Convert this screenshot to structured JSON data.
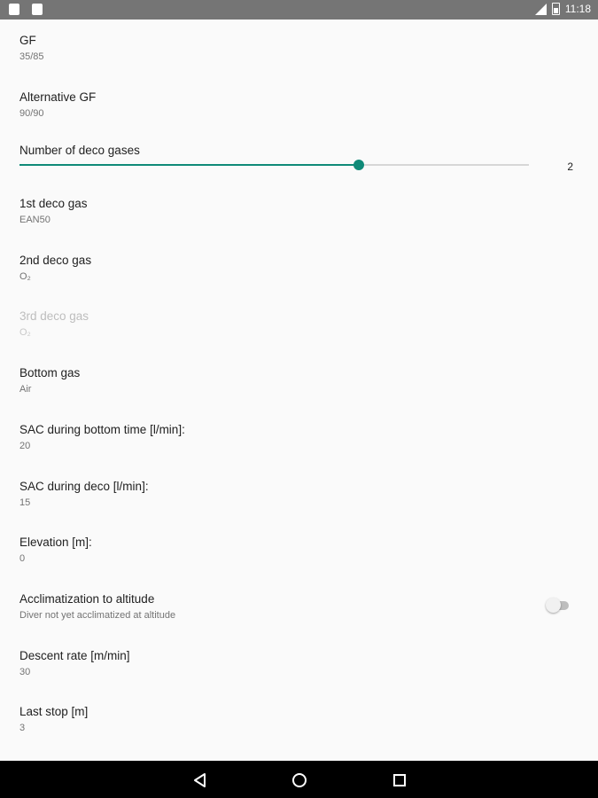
{
  "status_bar": {
    "time": "11:18",
    "left_icons": [
      "notification-icon",
      "notification-icon"
    ],
    "right_icons": [
      "signal-icon",
      "battery-icon"
    ]
  },
  "preferences": [
    {
      "id": "gf",
      "title": "GF",
      "summary": "35/85",
      "enabled": true
    },
    {
      "id": "alt-gf",
      "title": "Alternative GF",
      "summary": "90/90",
      "enabled": true
    },
    {
      "id": "deco-gases",
      "title": "Number of deco gases",
      "slider_value": "2",
      "slider_min": 0,
      "slider_max": 3,
      "enabled": true
    },
    {
      "id": "deco-gas-1",
      "title": "1st deco gas",
      "summary": "EAN50",
      "enabled": true
    },
    {
      "id": "deco-gas-2",
      "title": "2nd deco gas",
      "summary": "O₂",
      "enabled": true
    },
    {
      "id": "deco-gas-3",
      "title": "3rd deco gas",
      "summary": "O₂",
      "enabled": false
    },
    {
      "id": "bottom-gas",
      "title": "Bottom gas",
      "summary": "Air",
      "enabled": true
    },
    {
      "id": "sac-bottom",
      "title": "SAC during bottom time [l/min]:",
      "summary": "20",
      "enabled": true
    },
    {
      "id": "sac-deco",
      "title": "SAC during deco [l/min]:",
      "summary": "15",
      "enabled": true
    },
    {
      "id": "elevation",
      "title": "Elevation [m]:",
      "summary": "0",
      "enabled": true
    },
    {
      "id": "acclimatization",
      "title": "Acclimatization to altitude",
      "summary": "Diver not yet acclimatized at altitude",
      "switch_on": false,
      "enabled": true
    },
    {
      "id": "descent-rate",
      "title": "Descent rate [m/min]",
      "summary": "30",
      "enabled": true
    },
    {
      "id": "last-stop",
      "title": "Last stop [m]",
      "summary": "3",
      "enabled": true
    }
  ],
  "nav_bar": {
    "buttons": [
      "back-icon",
      "home-icon",
      "recents-icon"
    ]
  },
  "colors": {
    "accent": "#0f8a78",
    "status_bar": "#757575",
    "background": "#fafafa",
    "nav_bar": "#000000"
  }
}
